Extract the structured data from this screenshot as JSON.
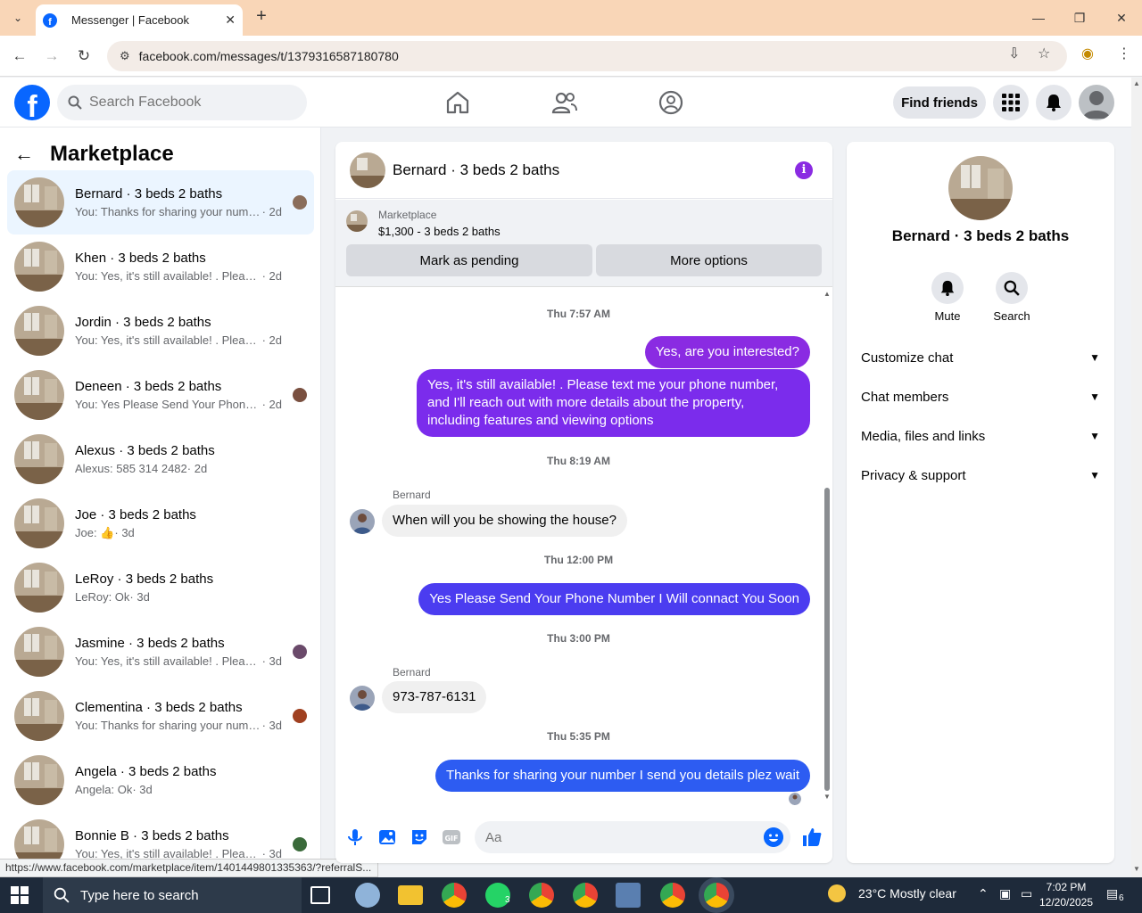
{
  "browser": {
    "tab_title": "Messenger | Facebook",
    "url": "facebook.com/messages/t/1379316587180780",
    "status_url": "https://www.facebook.com/marketplace/item/1401449801335363/?referralS..."
  },
  "header": {
    "search_placeholder": "Search Facebook",
    "find_friends": "Find friends"
  },
  "sidebar": {
    "title": "Marketplace",
    "conversations": [
      {
        "name": "Bernard · 3 beds 2 baths",
        "preview": "You: Thanks for sharing your numb...",
        "time": "· 2d",
        "active": true,
        "seen": "#8a6d5a"
      },
      {
        "name": "Khen · 3 beds 2 baths",
        "preview": "You: Yes, it's still available! . Please tex...",
        "time": "· 2d"
      },
      {
        "name": "Jordin · 3 beds 2 baths",
        "preview": "You: Yes, it's still available! . Please tex...",
        "time": "· 2d"
      },
      {
        "name": "Deneen · 3 beds 2 baths",
        "preview": "You: Yes Please Send Your Phone N...",
        "time": "· 2d",
        "seen": "#7a5040"
      },
      {
        "name": "Alexus · 3 beds 2 baths",
        "preview": "Alexus: 585 314 2482",
        "time": "· 2d"
      },
      {
        "name": "Joe · 3 beds 2 baths",
        "preview": "Joe: 👍",
        "time": "· 3d"
      },
      {
        "name": "LeRoy · 3 beds 2 baths",
        "preview": "LeRoy: Ok",
        "time": "· 3d"
      },
      {
        "name": "Jasmine · 3 beds 2 baths",
        "preview": "You: Yes, it's still available! . Please t...",
        "time": "· 3d",
        "seen": "#6a4a6a"
      },
      {
        "name": "Clementina · 3 beds 2 baths",
        "preview": "You: Thanks for sharing your numb...",
        "time": "· 3d",
        "seen": "#a04020"
      },
      {
        "name": "Angela · 3 beds 2 baths",
        "preview": "Angela: Ok",
        "time": "· 3d"
      },
      {
        "name": "Bonnie B · 3 beds 2 baths",
        "preview": "You: Yes, it's still available! . Please t...",
        "time": "· 3d",
        "seen": "#3a6a3a"
      }
    ]
  },
  "chat": {
    "title": "Bernard · 3 beds 2 baths",
    "marketplace_label": "Marketplace",
    "listing": "$1,300 - 3 beds 2 baths",
    "mark_pending": "Mark as pending",
    "more_options": "More options",
    "ts1": "Thu 7:57 AM",
    "out1": "Yes, are you interested?",
    "out2": "Yes, it's still available! . Please text me your phone number, and I'll reach out with more details about the property, including features and viewing options",
    "ts2": "Thu 8:19 AM",
    "sender1": "Bernard",
    "in1": "When will you be showing the house?",
    "ts3": "Thu 12:00 PM",
    "out3": "Yes Please Send Your Phone Number I Will connact You Soon",
    "ts4": "Thu 3:00 PM",
    "sender2": "Bernard",
    "in2": "973-787-6131",
    "ts5": "Thu 5:35 PM",
    "out4": "Thanks for sharing your number I send you details plez wait",
    "composer_placeholder": "Aa"
  },
  "info": {
    "name": "Bernard · 3 beds 2 baths",
    "mute": "Mute",
    "search": "Search",
    "rows": [
      "Customize chat",
      "Chat members",
      "Media, files and links",
      "Privacy & support"
    ]
  },
  "taskbar": {
    "search": "Type here to search",
    "weather": "23°C  Mostly clear",
    "time": "7:02 PM",
    "date": "12/20/2025",
    "whatsapp_badge": "3",
    "notif_badge": "6"
  },
  "colors": {
    "fb_blue": "#0866ff",
    "bubble_purple": "#8a2be2",
    "bubble_violet": "#6a2ee8",
    "bubble_blue": "#2d4ef5",
    "active_row": "#ebf5ff"
  }
}
